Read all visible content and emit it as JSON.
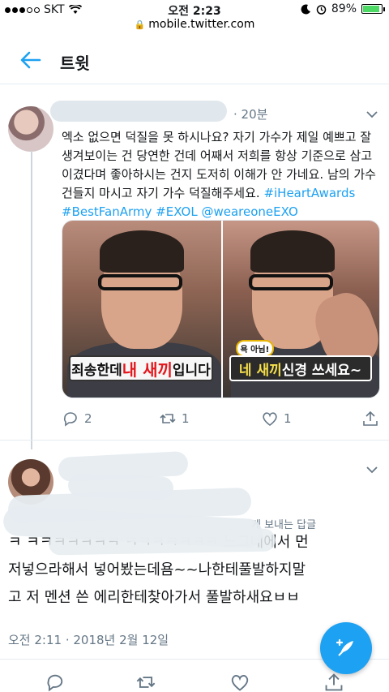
{
  "status_bar": {
    "carrier": "SKT",
    "time": "오전 2:23",
    "battery_percent": "89%",
    "battery_level": 0.89,
    "url": "mobile.twitter.com"
  },
  "header": {
    "title": "트윗"
  },
  "tweet1": {
    "time": "20분",
    "text_lines": [
      "엑소 없으면 덕질을 못 하시나요? 자기 가수가 제일 예쁘고 잘",
      "생겨보이는 건 당연한 건데 어째서 저희를 항상 기준으로 삼고",
      "이겼다며 좋아하시는 건지 도저히 이해가 안 가네요. 남의 가수",
      "건들지 마시고 자기 가수 덕질해주세요."
    ],
    "hashtags": [
      "#iHeartAwards",
      "#BestFanArmy",
      "#EXOL",
      "@weareoneEXO"
    ],
    "media": {
      "left_caption_pre": "죄송한데 ",
      "left_caption_red": "내 새끼",
      "left_caption_post": "입니다",
      "right_badge": "욕 아님!",
      "right_caption_yellow": "네 새끼",
      "right_caption_post": " 신경 쓰세요~"
    },
    "replies": "2",
    "retweets": "1",
    "likes": "1"
  },
  "tweet2": {
    "reply_context": "게 보내는 답글",
    "text_lines": [
      "ㅋ ㅋㅋㅋㅋㅋㅋㅋ ㅋㅋㅋㅋㅋㅋㅋ 느그네에서 먼",
      "저넣으라해서 넣어봤는데욤~~나한테풀발하지말",
      "고 저 멘션 쓴 에리한테찾아가서 풀발하새요ㅂㅂ"
    ],
    "date": "오전 2:11 · 2018년 2월 12일"
  },
  "icons": {
    "back": "back-arrow-icon",
    "chevron": "chevron-down-icon",
    "reply": "reply-icon",
    "retweet": "retweet-icon",
    "like": "heart-icon",
    "share": "share-icon",
    "compose": "compose-tweet-icon"
  },
  "colors": {
    "accent": "#1da1f2",
    "muted": "#657786"
  }
}
